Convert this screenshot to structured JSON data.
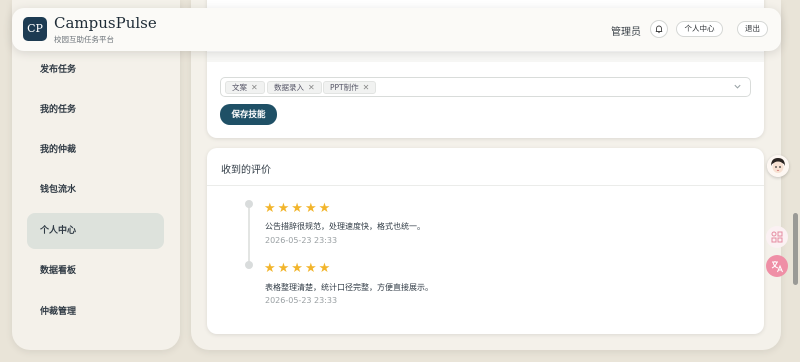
{
  "app": {
    "logo_text": "CP",
    "title": "CampusPulse",
    "subtitle": "校园互助任务平台"
  },
  "header": {
    "role": "管理员",
    "profile_label": "个人中心",
    "logout_label": "退出"
  },
  "sidebar": {
    "items": [
      {
        "label": "发布任务",
        "active": false
      },
      {
        "label": "我的任务",
        "active": false
      },
      {
        "label": "我的仲裁",
        "active": false
      },
      {
        "label": "钱包流水",
        "active": false
      },
      {
        "label": "个人中心",
        "active": true
      },
      {
        "label": "数据看板",
        "active": false
      },
      {
        "label": "仲裁管理",
        "active": false
      }
    ]
  },
  "skills": {
    "tags": [
      "文案",
      "数据录入",
      "PPT制作"
    ],
    "save_label": "保存技能"
  },
  "reviews": {
    "title": "收到的评价",
    "items": [
      {
        "rating": 5,
        "text": "公告措辞很规范，处理速度快，格式也统一。",
        "date": "2026-05-23 23:33"
      },
      {
        "rating": 5,
        "text": "表格整理清楚，统计口径完整，方便直接展示。",
        "date": "2026-05-23 23:33"
      }
    ]
  },
  "colors": {
    "accent": "#1f5066",
    "star": "#f2b52c",
    "background": "#e9e4d8"
  }
}
